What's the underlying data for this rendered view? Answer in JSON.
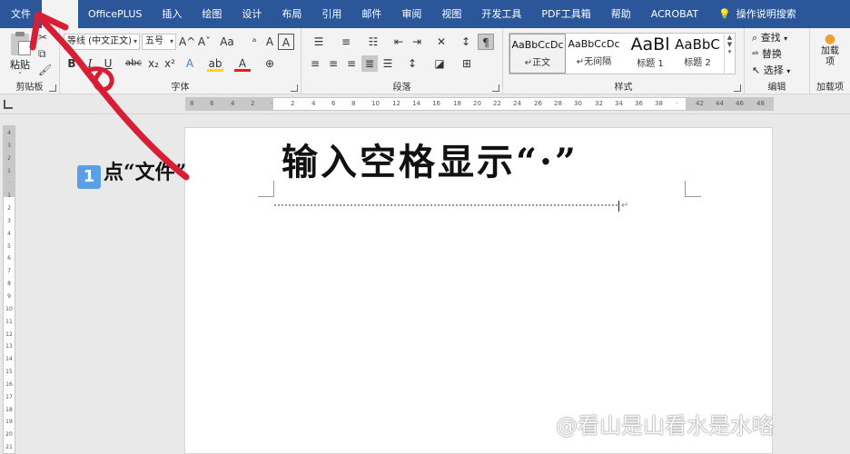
{
  "tabs": {
    "file": "文件",
    "home": "",
    "officeplus": "OfficePLUS",
    "insert": "插入",
    "draw": "绘图",
    "design": "设计",
    "layout": "布局",
    "references": "引用",
    "mailings": "邮件",
    "review": "审阅",
    "view": "视图",
    "developer": "开发工具",
    "pdf_tools": "PDF工具箱",
    "help": "帮助",
    "acrobat": "ACROBAT",
    "tell_me": "操作说明搜索"
  },
  "clipboard": {
    "paste_label": "粘贴",
    "group_label": "剪贴板"
  },
  "font": {
    "font_name": "等线 (中文正文)",
    "font_size": "五号",
    "group_label": "字体",
    "bold": "B",
    "italic": "I",
    "underline": "U",
    "strikethrough": "abc",
    "subscript": "x₂",
    "superscript": "x²",
    "grow": "A^",
    "shrink": "Aˇ",
    "case": "Aa",
    "text_effects": "A",
    "highlight": "ab",
    "font_color": "A",
    "clear_format": "A",
    "char_border": "A"
  },
  "paragraph": {
    "group_label": "段落"
  },
  "styles": {
    "group_label": "样式",
    "items": [
      {
        "sample": "AaBbCcDc",
        "name": "↵正文"
      },
      {
        "sample": "AaBbCcDc",
        "name": "↵无间隔"
      },
      {
        "sample": "AaBl",
        "name": "标题 1"
      },
      {
        "sample": "AaBbC",
        "name": "标题 2"
      }
    ]
  },
  "editing": {
    "find": "查找",
    "replace": "替换",
    "select": "选择",
    "group_label": "编辑"
  },
  "addins": {
    "label": "加载项",
    "button": "加载项"
  },
  "ruler": {
    "h_ticks": [
      "8",
      "6",
      "4",
      "2",
      "",
      "2",
      "4",
      "6",
      "8",
      "10",
      "12",
      "14",
      "16",
      "18",
      "20",
      "22",
      "24",
      "26",
      "28",
      "30",
      "32",
      "34",
      "36",
      "38",
      "",
      "42",
      "44",
      "46",
      "48"
    ],
    "v_ticks": [
      "4",
      "3",
      "2",
      "1",
      "",
      "1",
      "2",
      "3",
      "4",
      "5",
      "6",
      "7",
      "8",
      "9",
      "10",
      "11",
      "12",
      "13",
      "14",
      "15",
      "16",
      "17",
      "18",
      "19",
      "20",
      "21"
    ]
  },
  "overlay": {
    "headline": "输入空格显示“·”",
    "step_number": "1",
    "step_text": "点“文件”",
    "watermark": "@看山是山看水是水咯"
  },
  "document": {
    "paragraph_mark": "↵"
  },
  "colors": {
    "ribbon_blue": "#2b579a",
    "arrow_red": "#d61f35",
    "highlight_yellow": "#ffd900",
    "font_color_red": "#e02020"
  }
}
